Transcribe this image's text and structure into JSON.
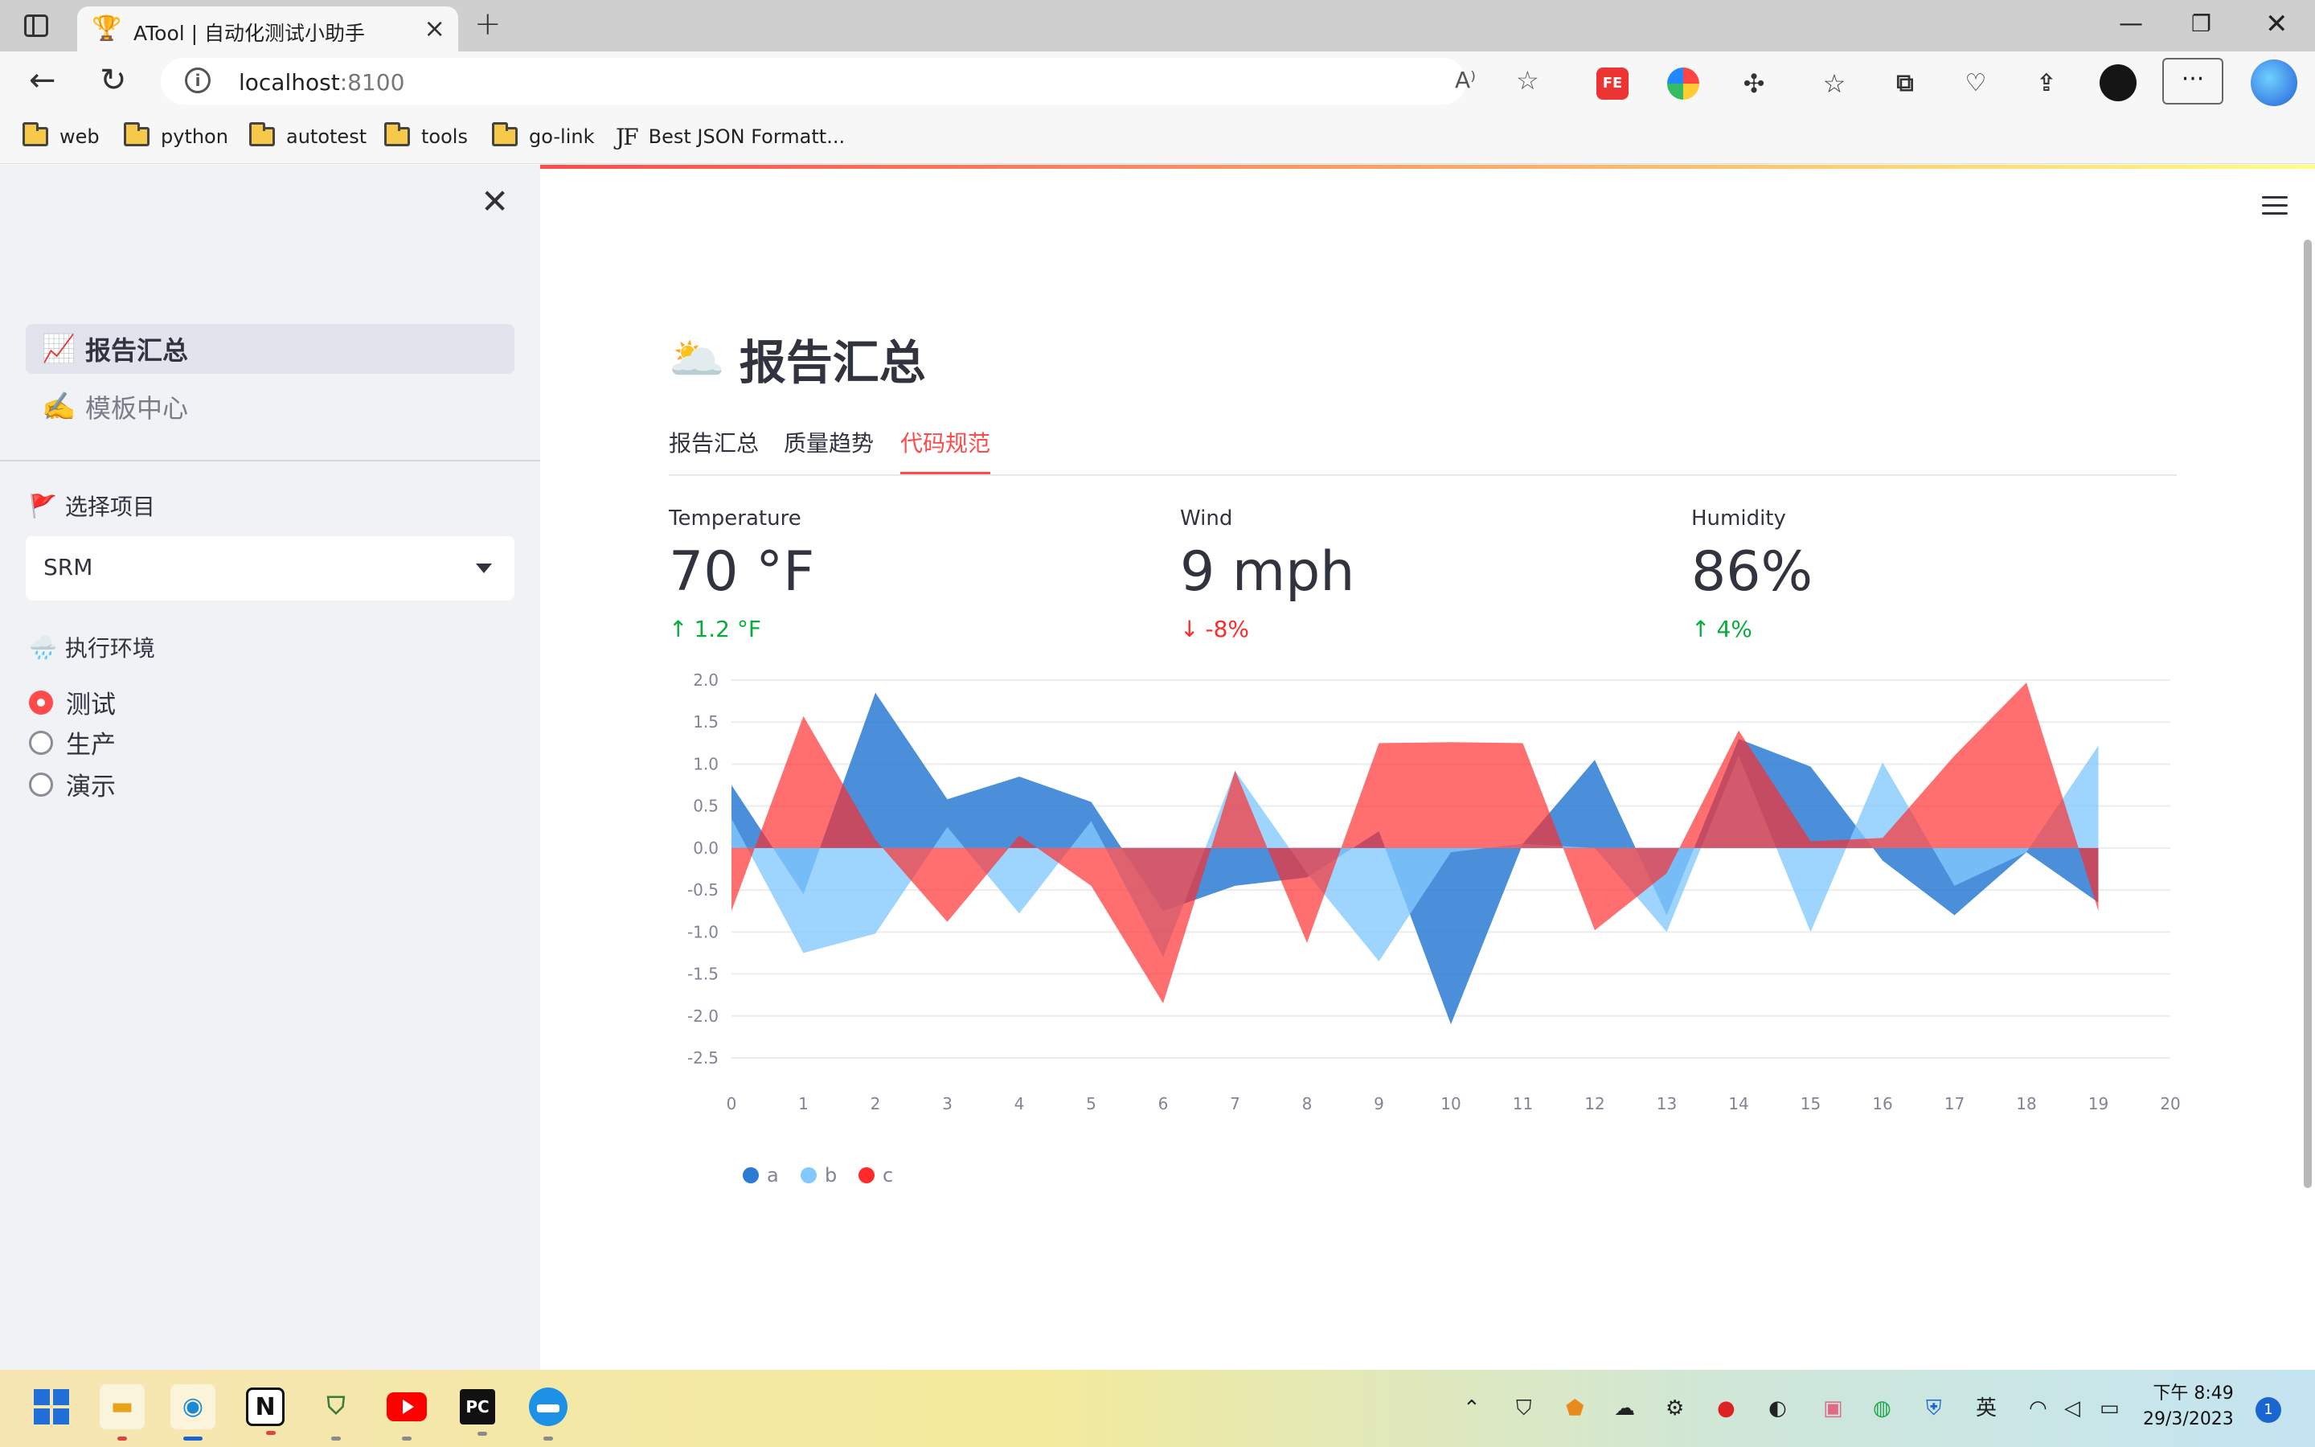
{
  "browser": {
    "tab_title": "ATool | 自动化测试小助手",
    "url_host": "localhost",
    "url_port": ":8100",
    "bookmarks": [
      "web",
      "python",
      "autotest",
      "tools",
      "go-link",
      "Best JSON Formatt..."
    ],
    "bookmark_jf_glyph": "JF"
  },
  "sidebar": {
    "nav": [
      {
        "emoji": "📈",
        "label": "报告汇总",
        "active": true
      },
      {
        "emoji": "✍️",
        "label": "模板中心",
        "active": false
      }
    ],
    "project_label": "选择项目",
    "project_emoji": "🚩",
    "project_value": "SRM",
    "env_label": "执行环境",
    "env_emoji": "🌧️",
    "env_options": [
      "测试",
      "生产",
      "演示"
    ],
    "env_selected": "测试"
  },
  "main": {
    "title_emoji": "🌥️",
    "title": "报告汇总",
    "tabs": [
      "报告汇总",
      "质量趋势",
      "代码规范"
    ],
    "selected_tab": "代码规范",
    "metrics": [
      {
        "label": "Temperature",
        "value": "70 °F",
        "delta": "1.2 °F",
        "direction": "up"
      },
      {
        "label": "Wind",
        "value": "9 mph",
        "delta": "-8%",
        "direction": "down"
      },
      {
        "label": "Humidity",
        "value": "86%",
        "delta": "4%",
        "direction": "up"
      }
    ]
  },
  "chart_data": {
    "type": "area",
    "x": [
      0,
      1,
      2,
      3,
      4,
      5,
      6,
      7,
      8,
      9,
      10,
      11,
      12,
      13,
      14,
      15,
      16,
      17,
      18,
      19
    ],
    "x_ticks": [
      0,
      1,
      2,
      3,
      4,
      5,
      6,
      7,
      8,
      9,
      10,
      11,
      12,
      13,
      14,
      15,
      16,
      17,
      18,
      19,
      20
    ],
    "y_ticks": [
      "2.0",
      "1.5",
      "1.0",
      "0.5",
      "0.0",
      "-0.5",
      "-1.0",
      "-1.5",
      "-2.0",
      "-2.5"
    ],
    "ylim": [
      -2.5,
      2.0
    ],
    "xlim": [
      0,
      20
    ],
    "grid": true,
    "legend_position": "bottom-left",
    "series": [
      {
        "name": "a",
        "color": "#2b7bd4",
        "values": [
          0.75,
          -0.55,
          1.85,
          0.58,
          0.85,
          0.55,
          -0.75,
          -0.45,
          -0.35,
          0.2,
          -2.1,
          0.05,
          1.05,
          -0.8,
          1.3,
          0.97,
          -0.15,
          -0.8,
          -0.05,
          -0.65
        ]
      },
      {
        "name": "b",
        "color": "#83c9ff",
        "values": [
          0.35,
          -1.25,
          -1.02,
          0.25,
          -0.78,
          0.32,
          -1.3,
          0.92,
          -0.3,
          -1.35,
          -0.05,
          0.05,
          0.0,
          -1.0,
          1.1,
          -1.0,
          1.02,
          -0.45,
          -0.05,
          1.22
        ]
      },
      {
        "name": "c",
        "color": "#ff2b2b",
        "values": [
          -0.75,
          1.57,
          0.1,
          -0.88,
          0.15,
          -0.45,
          -1.85,
          0.92,
          -1.13,
          1.25,
          1.26,
          1.25,
          -0.98,
          -0.3,
          1.4,
          0.08,
          0.12,
          1.1,
          1.97,
          -0.75
        ]
      }
    ]
  },
  "taskbar": {
    "apps": [
      "windows-start",
      "file-explorer",
      "edge",
      "notion",
      "security",
      "youtube",
      "pycharm",
      "docker"
    ],
    "ime": "英",
    "time": "下午 8:49",
    "date": "29/3/2023",
    "notification_count": "1"
  }
}
